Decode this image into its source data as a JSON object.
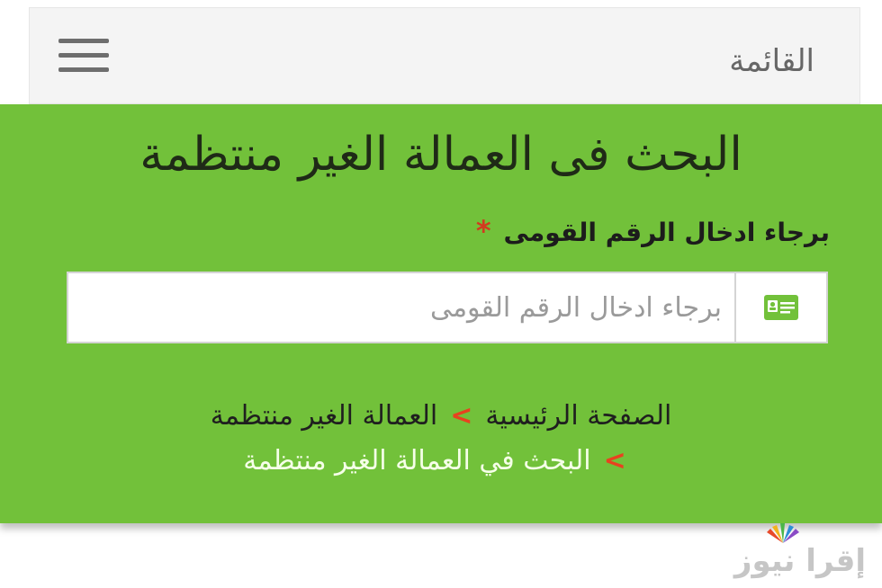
{
  "header": {
    "menu_title": "القائمة"
  },
  "panel": {
    "title": "البحث فى العمالة الغير منتظمة",
    "field_label": "برجاء ادخال الرقم القومى",
    "required_mark": "*",
    "input": {
      "value": "",
      "placeholder": "برجاء ادخال الرقم القومى"
    }
  },
  "breadcrumb": {
    "home": "الصفحة الرئيسية",
    "separator": ">",
    "section": "العمالة الغير منتظمة",
    "current": "البحث في العمالة الغير منتظمة"
  },
  "watermark": {
    "text": "إقرا نيوز"
  },
  "colors": {
    "panel_green": "#72c13a",
    "separator_red": "#e8421f",
    "icon_green": "#72c13a"
  },
  "icons": [
    "hamburger-menu-icon",
    "id-card-icon"
  ]
}
